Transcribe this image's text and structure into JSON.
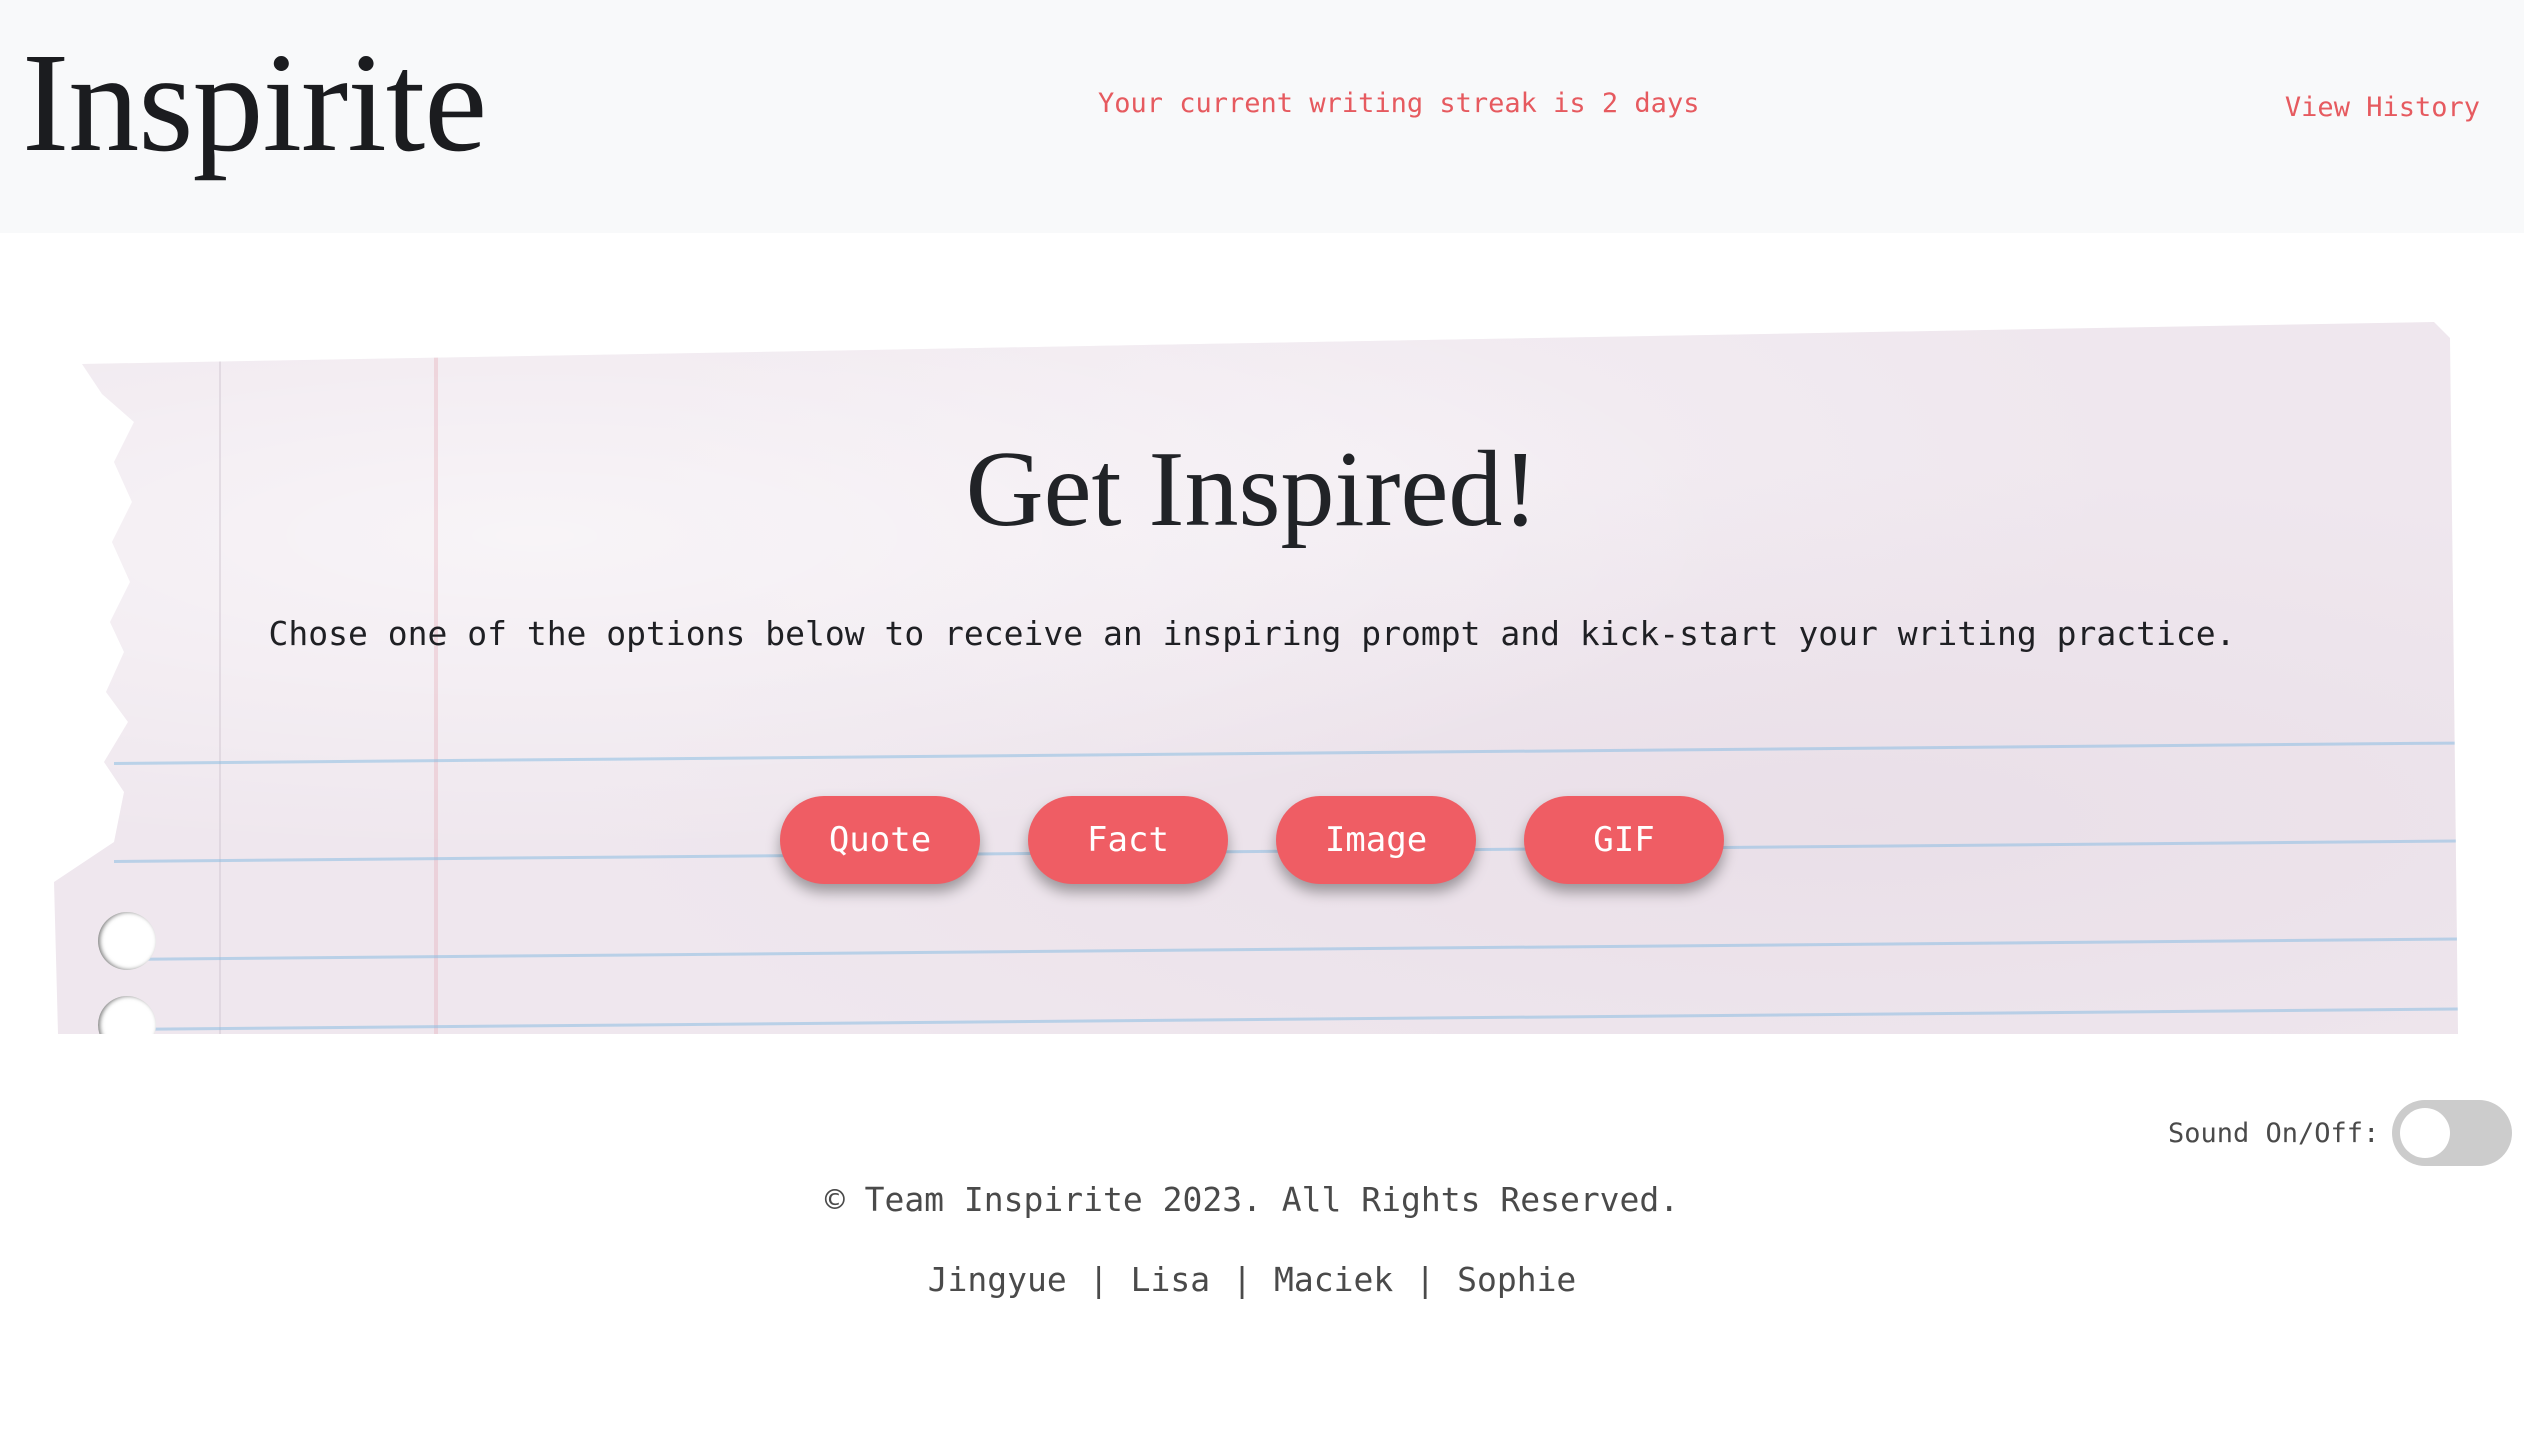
{
  "header": {
    "logo": "Inspirite",
    "streak_text": "Your current writing streak is 2 days",
    "history_label": "View History"
  },
  "main": {
    "title": "Get Inspired!",
    "subtitle": "Chose one of the options below to receive an inspiring prompt and kick-start your writing practice.",
    "buttons": [
      {
        "label": "Quote"
      },
      {
        "label": "Fact"
      },
      {
        "label": "Image"
      },
      {
        "label": "GIF"
      }
    ]
  },
  "footer": {
    "sound_label": "Sound On/Off:",
    "sound_on": false,
    "copyright": "© Team Inspirite 2023. All Rights Reserved.",
    "team": [
      "Jingyue",
      "Lisa",
      "Maciek",
      "Sophie"
    ],
    "team_separator": "|"
  },
  "colors": {
    "accent": "#ef5d64",
    "link": "#e65a5f",
    "header_bg": "#f8f9fa",
    "paper": "#efe7ee"
  },
  "icons": {
    "sound_toggle": "toggle-switch-icon"
  }
}
